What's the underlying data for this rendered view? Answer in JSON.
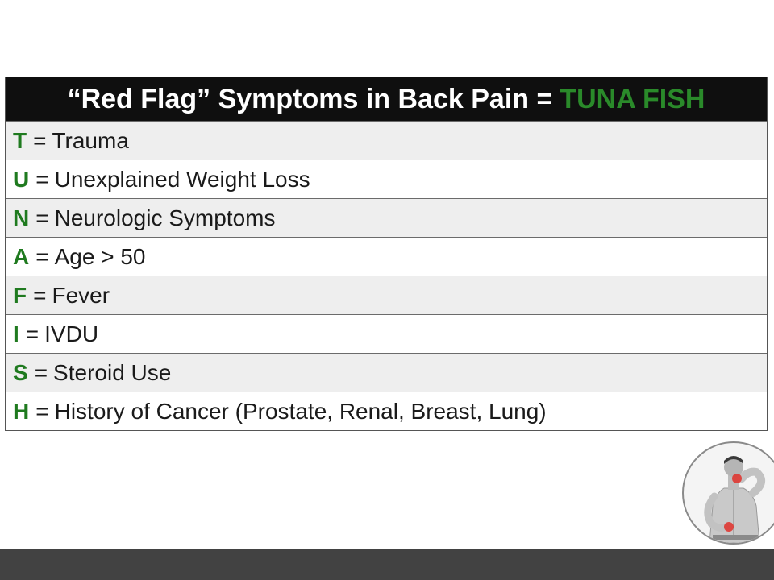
{
  "title": {
    "main": "“Red Flag” Symptoms in Back Pain =",
    "accent": "TUNA FISH"
  },
  "colors": {
    "title_bar": "#0f0f0f",
    "accent_green": "#2a8a2a",
    "row_shaded": "#eeeeee",
    "row_plain": "#ffffff",
    "footer": "#424242"
  },
  "rows": [
    {
      "letter": "T",
      "eq": "=",
      "text": "Trauma"
    },
    {
      "letter": "U",
      "eq": "=",
      "text": "Unexplained Weight Loss"
    },
    {
      "letter": "N",
      "eq": "=",
      "text": "Neurologic Symptoms"
    },
    {
      "letter": "A",
      "eq": "=",
      "text": "Age > 50"
    },
    {
      "letter": "F",
      "eq": "=",
      "text": "Fever"
    },
    {
      "letter": "I",
      "eq": "=",
      "text": "IVDU"
    },
    {
      "letter": "S",
      "eq": "=",
      "text": "Steroid Use"
    },
    {
      "letter": "H",
      "eq": "=",
      "text": "History of Cancer (Prostate, Renal, Breast, Lung)"
    }
  ],
  "image": {
    "icon": "back-pain-photo-icon"
  }
}
